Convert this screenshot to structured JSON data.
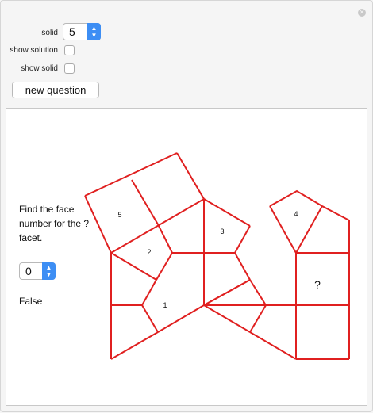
{
  "controls": {
    "solid_label": "solid",
    "solid_value": "5",
    "show_solution_label": "show solution",
    "show_solution_checked": false,
    "show_solid_label": "show solid",
    "show_solid_checked": false,
    "new_question_label": "new question"
  },
  "panel": {
    "prompt": "Find the face number for the ? facet.",
    "answer_value": "0",
    "result_text": "False"
  },
  "net": {
    "line_color": "#e02020",
    "face_labels": [
      "5",
      "2",
      "3",
      "1",
      "4"
    ],
    "unknown_label": "?"
  },
  "icons": {
    "close": "close-icon",
    "stepper": "stepper-arrows-icon"
  }
}
